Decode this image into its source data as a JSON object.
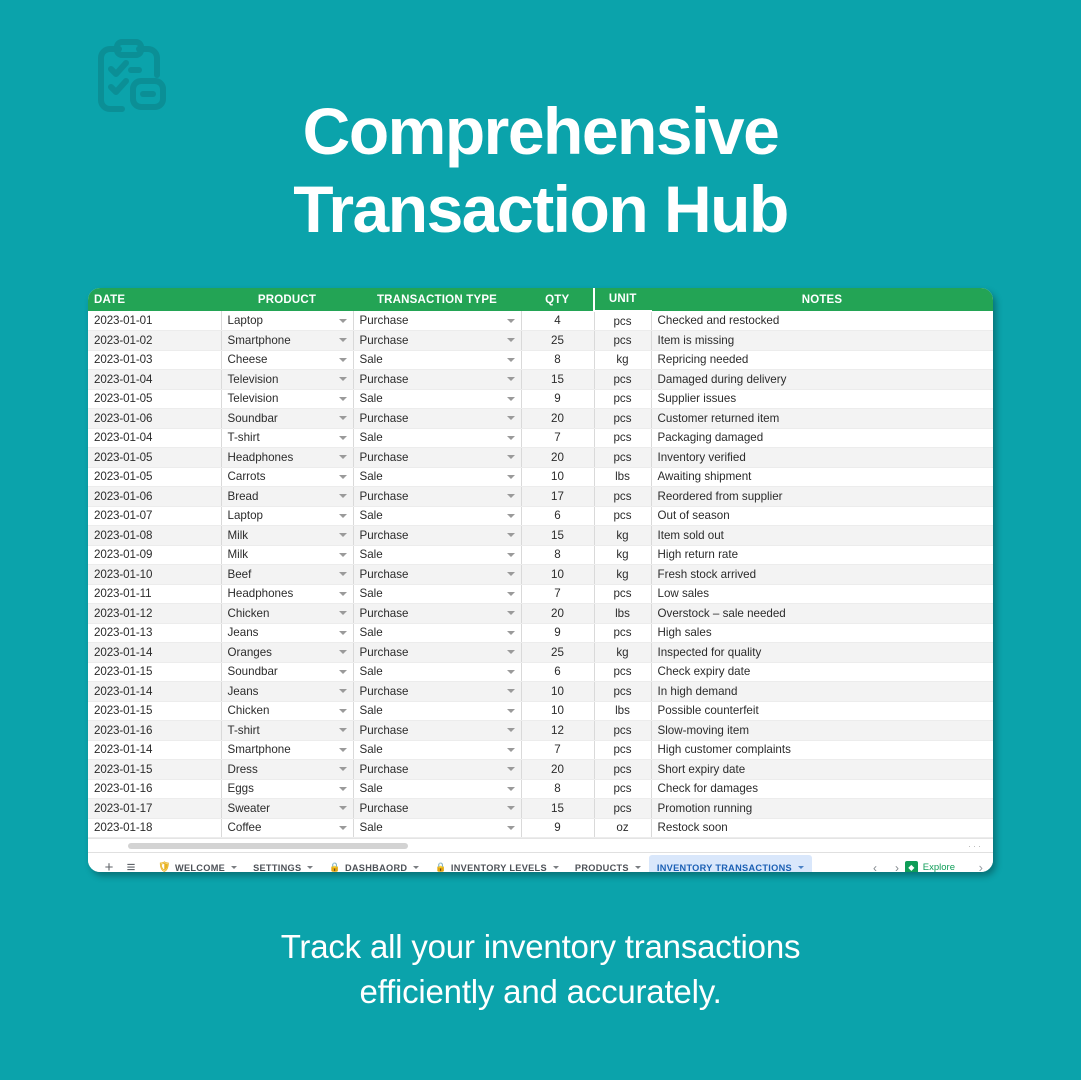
{
  "theme": {
    "background": "#0ba3ab",
    "logo_color": "#0b8f96",
    "header_green": "#23a455",
    "active_tab_bg": "#d9e7fb",
    "active_tab_text": "#1a5fb4",
    "explore_green": "#0f9d58"
  },
  "logo": {
    "icon": "clipboard-checklist-icon"
  },
  "headline": {
    "line1": "Comprehensive",
    "line2": "Transaction Hub"
  },
  "caption": {
    "line1": "Track all your inventory transactions",
    "line2": "efficiently and accurately."
  },
  "spreadsheet": {
    "columns": [
      {
        "key": "date",
        "label": "DATE"
      },
      {
        "key": "product",
        "label": "PRODUCT"
      },
      {
        "key": "type",
        "label": "TRANSACTION TYPE"
      },
      {
        "key": "qty",
        "label": "QTY"
      },
      {
        "key": "unit",
        "label": "UNIT",
        "selected": true
      },
      {
        "key": "notes",
        "label": "NOTES"
      }
    ],
    "rows": [
      {
        "date": "2023-01-01",
        "product": "Laptop",
        "type": "Purchase",
        "qty": "4",
        "unit": "pcs",
        "notes": "Checked and restocked"
      },
      {
        "date": "2023-01-02",
        "product": "Smartphone",
        "type": "Purchase",
        "qty": "25",
        "unit": "pcs",
        "notes": "Item is missing"
      },
      {
        "date": "2023-01-03",
        "product": "Cheese",
        "type": "Sale",
        "qty": "8",
        "unit": "kg",
        "notes": "Repricing needed"
      },
      {
        "date": "2023-01-04",
        "product": "Television",
        "type": "Purchase",
        "qty": "15",
        "unit": "pcs",
        "notes": "Damaged during delivery"
      },
      {
        "date": "2023-01-05",
        "product": "Television",
        "type": "Sale",
        "qty": "9",
        "unit": "pcs",
        "notes": "Supplier issues"
      },
      {
        "date": "2023-01-06",
        "product": "Soundbar",
        "type": "Purchase",
        "qty": "20",
        "unit": "pcs",
        "notes": "Customer returned item"
      },
      {
        "date": "2023-01-04",
        "product": "T-shirt",
        "type": "Sale",
        "qty": "7",
        "unit": "pcs",
        "notes": "Packaging damaged"
      },
      {
        "date": "2023-01-05",
        "product": "Headphones",
        "type": "Purchase",
        "qty": "20",
        "unit": "pcs",
        "notes": "Inventory verified"
      },
      {
        "date": "2023-01-05",
        "product": "Carrots",
        "type": "Sale",
        "qty": "10",
        "unit": "lbs",
        "notes": "Awaiting shipment"
      },
      {
        "date": "2023-01-06",
        "product": "Bread",
        "type": "Purchase",
        "qty": "17",
        "unit": "pcs",
        "notes": "Reordered from supplier"
      },
      {
        "date": "2023-01-07",
        "product": "Laptop",
        "type": "Sale",
        "qty": "6",
        "unit": "pcs",
        "notes": "Out of season"
      },
      {
        "date": "2023-01-08",
        "product": "Milk",
        "type": "Purchase",
        "qty": "15",
        "unit": "kg",
        "notes": "Item sold out"
      },
      {
        "date": "2023-01-09",
        "product": "Milk",
        "type": "Sale",
        "qty": "8",
        "unit": "kg",
        "notes": "High return rate"
      },
      {
        "date": "2023-01-10",
        "product": "Beef",
        "type": "Purchase",
        "qty": "10",
        "unit": "kg",
        "notes": "Fresh stock arrived"
      },
      {
        "date": "2023-01-11",
        "product": "Headphones",
        "type": "Sale",
        "qty": "7",
        "unit": "pcs",
        "notes": "Low sales"
      },
      {
        "date": "2023-01-12",
        "product": "Chicken",
        "type": "Purchase",
        "qty": "20",
        "unit": "lbs",
        "notes": "Overstock – sale needed"
      },
      {
        "date": "2023-01-13",
        "product": "Jeans",
        "type": "Sale",
        "qty": "9",
        "unit": "pcs",
        "notes": "High sales"
      },
      {
        "date": "2023-01-14",
        "product": "Oranges",
        "type": "Purchase",
        "qty": "25",
        "unit": "kg",
        "notes": "Inspected for quality"
      },
      {
        "date": "2023-01-15",
        "product": "Soundbar",
        "type": "Sale",
        "qty": "6",
        "unit": "pcs",
        "notes": "Check expiry date"
      },
      {
        "date": "2023-01-14",
        "product": "Jeans",
        "type": "Purchase",
        "qty": "10",
        "unit": "pcs",
        "notes": "In high demand"
      },
      {
        "date": "2023-01-15",
        "product": "Chicken",
        "type": "Sale",
        "qty": "10",
        "unit": "lbs",
        "notes": "Possible counterfeit"
      },
      {
        "date": "2023-01-16",
        "product": "T-shirt",
        "type": "Purchase",
        "qty": "12",
        "unit": "pcs",
        "notes": "Slow-moving item"
      },
      {
        "date": "2023-01-14",
        "product": "Smartphone",
        "type": "Sale",
        "qty": "7",
        "unit": "pcs",
        "notes": "High customer complaints"
      },
      {
        "date": "2023-01-15",
        "product": "Dress",
        "type": "Purchase",
        "qty": "20",
        "unit": "pcs",
        "notes": "Short expiry date"
      },
      {
        "date": "2023-01-16",
        "product": "Eggs",
        "type": "Sale",
        "qty": "8",
        "unit": "pcs",
        "notes": "Check for damages"
      },
      {
        "date": "2023-01-17",
        "product": "Sweater",
        "type": "Purchase",
        "qty": "15",
        "unit": "pcs",
        "notes": "Promotion running"
      },
      {
        "date": "2023-01-18",
        "product": "Coffee",
        "type": "Sale",
        "qty": "9",
        "unit": "oz",
        "notes": "Restock soon"
      }
    ]
  },
  "tabbar": {
    "add_label": "+",
    "all_sheets_label": "≡",
    "tabs": [
      {
        "label": "WELCOME",
        "icon": "shield-icon",
        "active": false
      },
      {
        "label": "SETTINGS",
        "icon": "none",
        "active": false
      },
      {
        "label": "DASHBAORD",
        "icon": "lock-icon",
        "active": false
      },
      {
        "label": "INVENTORY LEVELS",
        "icon": "lock-icon",
        "active": false
      },
      {
        "label": "PRODUCTS",
        "icon": "none",
        "active": false
      },
      {
        "label": "INVENTORY TRANSACTIONS",
        "icon": "none",
        "active": true
      }
    ],
    "prev_label": "‹",
    "next_label": "›",
    "explore_label": "Explore",
    "edge_label": "›"
  }
}
